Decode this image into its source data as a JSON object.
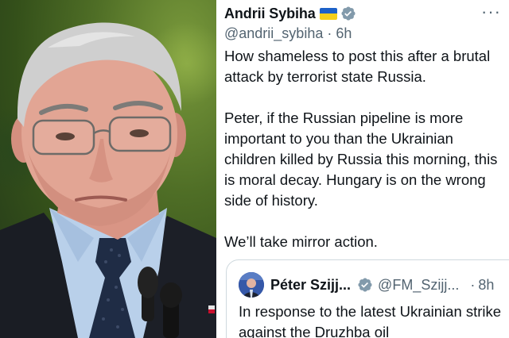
{
  "tweet": {
    "author_name": "Andrii Sybiha",
    "flag_icon": "ukraine-flag-icon",
    "verified_icon": "verified-badge-icon",
    "handle": "@andrii_sybiha",
    "separator": "·",
    "time": "6h",
    "more_label": "···",
    "paragraphs": [
      "How shameless to post this after a brutal attack by terrorist state Russia.",
      "Peter, if the Russian pipeline is more important to you than the Ukrainian children killed by Russia this morning, this is moral decay. Hungary is on the wrong side of history.",
      "We’ll take mirror action."
    ]
  },
  "quote": {
    "author_name": "Péter Szijj...",
    "handle": "@FM_Szijj...",
    "separator": "·",
    "time": "8h",
    "text": "In response to the latest Ukrainian strike against the Druzhba oil"
  },
  "colors": {
    "verified_blue": "#1d9bf0",
    "verified_gray": "#829aab",
    "secondary_text": "#536471",
    "flag_blue": "#1d61c8",
    "flag_yellow": "#f5cf1b"
  }
}
